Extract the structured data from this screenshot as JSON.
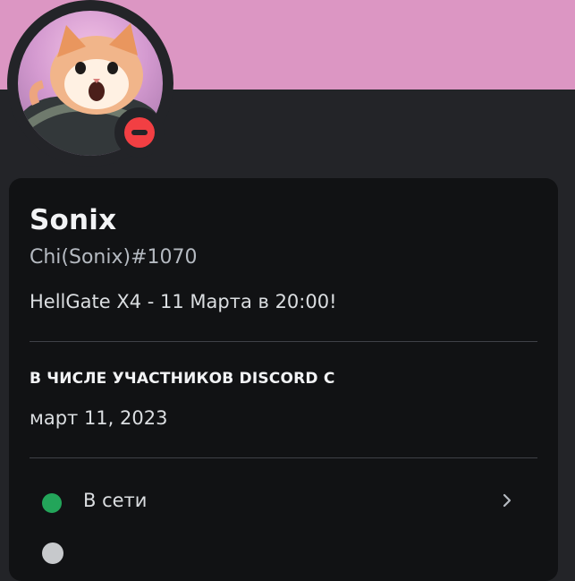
{
  "profile": {
    "display_name": "Sonix",
    "username": "Chi(Sonix)#1070",
    "custom_status": "HellGate X4 - 11 Марта в 20:00!",
    "status": "dnd",
    "banner_color": "#dc96c3"
  },
  "member_since": {
    "title": "В ЧИСЛЕ УЧАСТНИКОВ DISCORD С",
    "date": "март 11, 2023"
  },
  "status_menu": {
    "current_label": "В сети",
    "current_color": "#23a55a",
    "next_item_color": "#c7c9cc"
  },
  "icons": {
    "avatar": "cat-in-helmet-avatar",
    "status": "do-not-disturb-icon",
    "online": "online-status-icon",
    "chevron": "chevron-right-icon"
  }
}
